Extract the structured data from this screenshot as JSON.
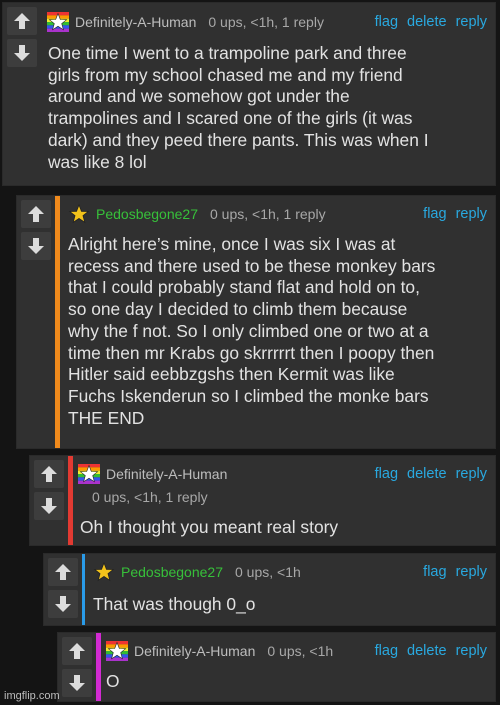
{
  "actions": {
    "flag": "flag",
    "delete": "delete",
    "reply": "reply"
  },
  "comments": [
    {
      "user": "Definitely-A-Human",
      "meta": "0 ups, <1h, 1 reply",
      "text": "One time I went to a trampoline park and three\ngirls from my school chased me and my friend\naround and we somehow got under the\ntrampolines and I scared one of the girls (it was\ndark) and they peed there pants. This was when I\nwas like 8 lol"
    },
    {
      "user": "Pedosbegone27",
      "meta": "0 ups, <1h, 1 reply",
      "text": "Alright here’s mine, once I was six I was at\nrecess and there used to be these monkey bars\nthat I could probably stand flat and hold on to,\nso one day I decided to climb them because\nwhy the f not. So I only climbed one or two at a\ntime then mr Krabs go skrrrrrt then I poopy then\nHitler said eebbzgshs then Kermit was like\nFuchs Iskenderun so I climbed the monke bars\nTHE END"
    },
    {
      "user": "Definitely-A-Human",
      "meta": "0 ups, <1h, 1 reply",
      "text": "Oh I thought you meant real story"
    },
    {
      "user": "Pedosbegone27",
      "meta": "0 ups, <1h",
      "text": "That was though 0_o"
    },
    {
      "user": "Definitely-A-Human",
      "meta": "0 ups, <1h",
      "text": "O"
    }
  ],
  "footer": "imgflip.com",
  "colors": {
    "background": "#141414",
    "card": "#303030",
    "link": "#29a9e0",
    "username_green": "#37c03a",
    "thread_orange": "#f08a1c",
    "thread_red": "#e23a32",
    "thread_blue": "#2a9be8",
    "thread_magenta": "#d22ad2"
  },
  "icons": [
    "upvote-arrow-icon",
    "downvote-arrow-icon",
    "rainbow-star-badge-icon",
    "gold-star-badge-icon"
  ]
}
